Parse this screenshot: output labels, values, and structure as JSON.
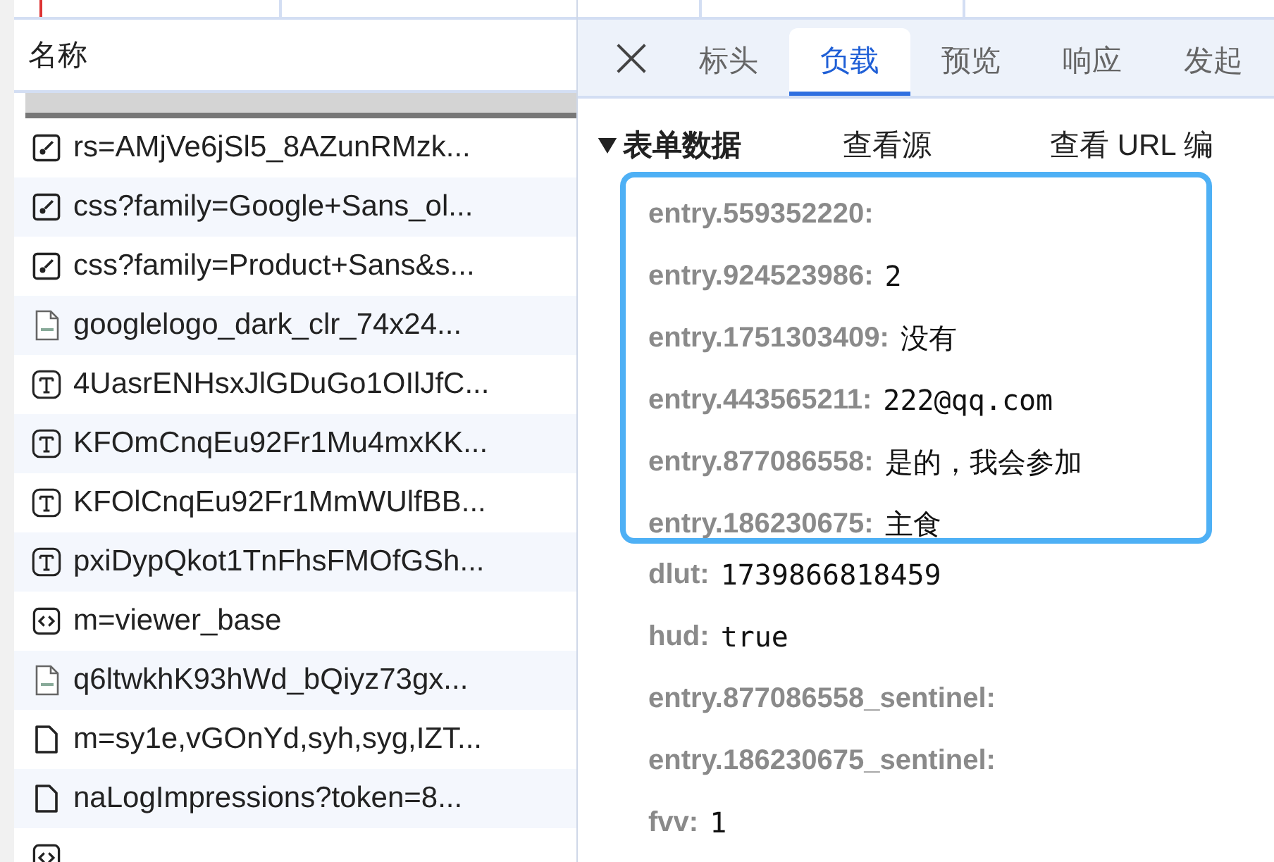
{
  "requests_panel": {
    "header": "名称",
    "partial_row": {
      "selected": true
    },
    "rows": [
      {
        "kind": "stylesheet",
        "name": "rs=AMjVe6jSl5_8AZunRMzk..."
      },
      {
        "kind": "stylesheet",
        "name": "css?family=Google+Sans_ol..."
      },
      {
        "kind": "stylesheet",
        "name": "css?family=Product+Sans&s..."
      },
      {
        "kind": "image",
        "name": "googlelogo_dark_clr_74x24..."
      },
      {
        "kind": "font",
        "name": "4UasrENHsxJlGDuGo1OIlJfC..."
      },
      {
        "kind": "font",
        "name": "KFOmCnqEu92Fr1Mu4mxKK..."
      },
      {
        "kind": "font",
        "name": "KFOlCnqEu92Fr1MmWUlfBB..."
      },
      {
        "kind": "font",
        "name": "pxiDypQkot1TnFhsFMOfGSh..."
      },
      {
        "kind": "script",
        "name": "m=viewer_base"
      },
      {
        "kind": "image",
        "name": "q6ltwkhK93hWd_bQiyz73gx..."
      },
      {
        "kind": "document",
        "name": "m=sy1e,vGOnYd,syh,syg,IZT..."
      },
      {
        "kind": "document",
        "name": "naLogImpressions?token=8..."
      },
      {
        "kind": "script"
      }
    ]
  },
  "details": {
    "close": "×",
    "tabs": [
      {
        "label": "标头",
        "selected": false
      },
      {
        "label": "负载",
        "selected": true
      },
      {
        "label": "预览",
        "selected": false
      },
      {
        "label": "响应",
        "selected": false
      },
      {
        "label": "发起",
        "selected": false
      }
    ],
    "form_data": {
      "title": "表单数据",
      "expanded": true,
      "actions": [
        "查看源",
        "查看 URL 编"
      ],
      "highlighted_entries": [
        {
          "key": "entry.559352220:"
        },
        {
          "key": "entry.924523986:",
          "value": "2"
        },
        {
          "key": "entry.1751303409:",
          "value": "没有"
        },
        {
          "key": "entry.443565211:",
          "value": "222@qq.com"
        },
        {
          "key": "entry.877086558:",
          "value": "是的，我会参加"
        },
        {
          "key": "entry.186230675:",
          "value": "主食"
        }
      ],
      "entries": [
        {
          "key": "dlut:",
          "value": "1739866818459"
        },
        {
          "key": "hud:",
          "value": "true"
        },
        {
          "key": "entry.877086558_sentinel:"
        },
        {
          "key": "entry.186230675_sentinel:"
        },
        {
          "key": "fvv:",
          "value": "1"
        }
      ]
    }
  }
}
